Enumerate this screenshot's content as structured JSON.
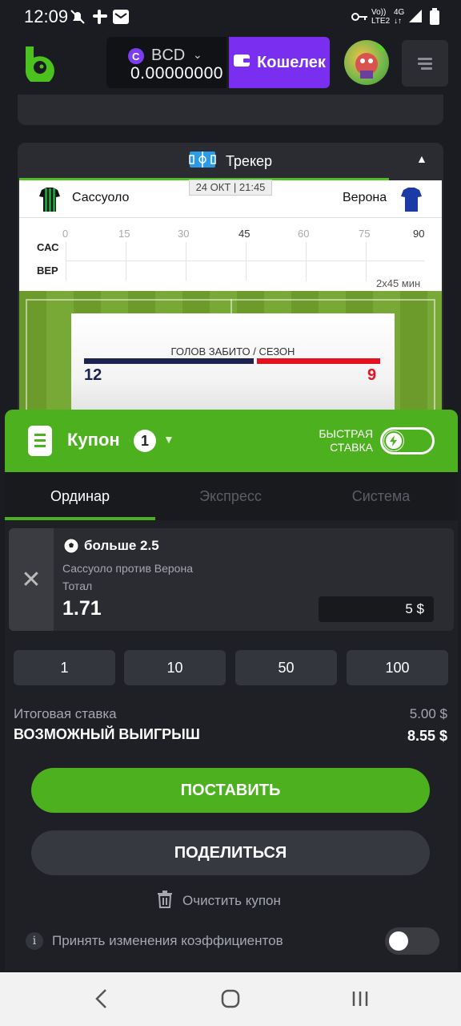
{
  "status": {
    "time": "12:09",
    "net1": "Vo))",
    "net1b": "LTE2",
    "net2": "4G"
  },
  "header": {
    "currency": "BCD",
    "balance": "0.00000000",
    "wallet_label": "Кошелек"
  },
  "tracker": {
    "title": "Трекер",
    "home_team": "Сассуоло",
    "away_team": "Верона",
    "datetime": "24 ОКТ | 21:45",
    "ticks": [
      "0",
      "15",
      "30",
      "45",
      "60",
      "75",
      "90"
    ],
    "row_home": "САС",
    "row_away": "ВЕР",
    "duration": "2х45 мин",
    "stat_title": "ГОЛОВ ЗАБИТО / СЕЗОН",
    "stat_home": "12",
    "stat_away": "9",
    "colors": {
      "home": "#1d2350",
      "away": "#e4121e"
    }
  },
  "coupon": {
    "title": "Купон",
    "count": "1",
    "fast_bet_line1": "БЫСТРАЯ",
    "fast_bet_line2": "СТАВКА",
    "tabs": [
      "Ординар",
      "Экспресс",
      "Система"
    ],
    "bet": {
      "selection": "больше 2.5",
      "match": "Сассуоло против Верона",
      "market": "Тотал",
      "odds": "1.71",
      "stake": "5 $"
    },
    "quick_amounts": [
      "1",
      "10",
      "50",
      "100"
    ],
    "total_stake_label": "Итоговая ставка",
    "total_stake_value": "5.00 $",
    "potential_win_label": "ВОЗМОЖНЫЙ ВЫИГРЫШ",
    "potential_win_value": "8.55 $",
    "place_bet_label": "ПОСТАВИТЬ",
    "share_label": "ПОДЕЛИТЬСЯ",
    "clear_label": "Очистить купон",
    "accept_changes_label": "Принять изменения коэффициентов"
  },
  "colors": {
    "accent": "#4cb01f",
    "wallet": "#7a2ff0",
    "background": "#1b1c21"
  }
}
